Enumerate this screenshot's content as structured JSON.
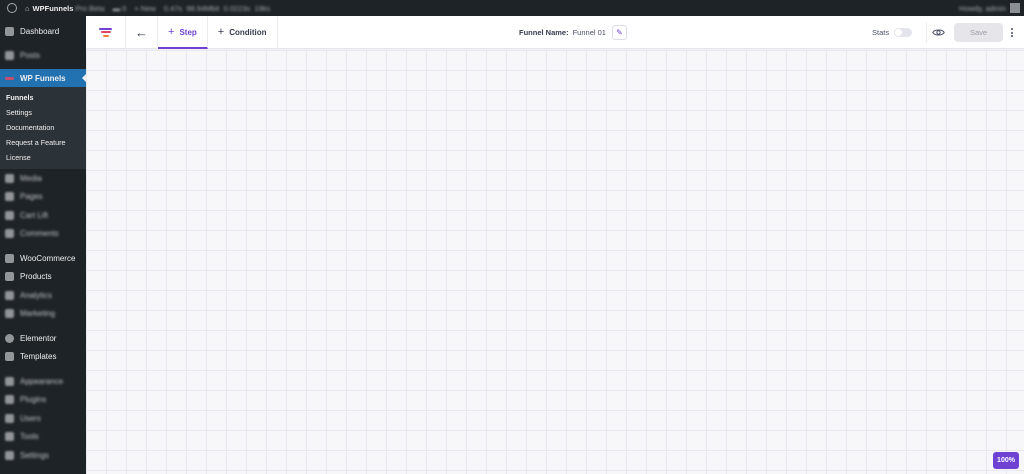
{
  "admin_bar": {
    "site_name": "WPFunnels",
    "site_suffix": "Pro Beta",
    "comments": "0",
    "new": "New",
    "stat1": "0.47s",
    "stat2": "98.94Mbit",
    "stat3": "0.0223s",
    "stat4": "19ks",
    "greeting": "Howdy, admin"
  },
  "sidebar": {
    "dashboard": "Dashboard",
    "posts": "Posts",
    "wpfunnels": "WP Funnels",
    "submenu": [
      "Funnels",
      "Settings",
      "Documentation",
      "Request a Feature",
      "License"
    ],
    "media": "Media",
    "pages": "Pages",
    "cartlift": "Cart Lift",
    "comments": "Comments",
    "woocommerce": "WooCommerce",
    "products": "Products",
    "analytics": "Analytics",
    "marketing": "Marketing",
    "elementor": "Elementor",
    "templates": "Templates",
    "appearance": "Appearance",
    "plugins": "Plugins",
    "users": "Users",
    "tools": "Tools",
    "settings": "Settings"
  },
  "toolbar": {
    "step_label": "Step",
    "condition_label": "Condition",
    "funnel_name_label": "Funnel Name:",
    "funnel_name_value": "Funnel 01",
    "stats_label": "Stats",
    "save_label": "Save"
  },
  "canvas": {
    "zoom_label": "100%"
  },
  "colors": {
    "accent": "#6e42d3",
    "wp_active": "#2271b1",
    "sidebar_bg": "#1d2327"
  }
}
